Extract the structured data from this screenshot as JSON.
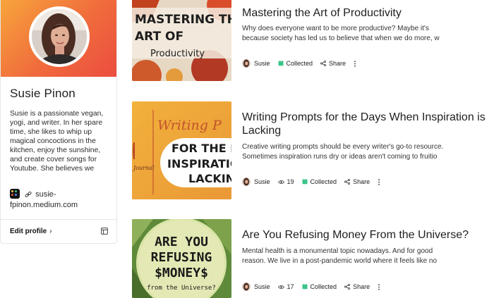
{
  "profile": {
    "name": "Susie Pinon",
    "bio": "Susie is a passionate vegan, yogi, and writer. In her spare time, she likes to whip up magical concoctions in the kitchen, enjoy the sunshine, and create cover songs for Youtube. She believes we",
    "link_line1": "susie-",
    "link_line2": "fpinon.medium.com",
    "edit_label": "Edit profile",
    "edit_chevron": "›"
  },
  "articles": [
    {
      "title": "Mastering the Art of Productivity",
      "excerpt_line1": "Why does everyone want to be more productive? Maybe it's",
      "excerpt_line2": "because society has led us to believe that when we do more, w",
      "thumb_text": [
        "MASTERING THE",
        "ART OF",
        "Productivity"
      ],
      "author": "Susie",
      "views": "",
      "collected": "Collected",
      "share": "Share"
    },
    {
      "title": "Writing Prompts for the Days When Inspiration is Lacking",
      "excerpt_line1": "Creative writing prompts should be every writer's go-to resource.",
      "excerpt_line2": "Sometimes inspiration runs dry or ideas aren't coming to fruitio",
      "thumb_text": [
        "Writing P",
        "FOR THE D",
        "INSPIRATIO",
        "LACKIN",
        "Journal"
      ],
      "author": "Susie",
      "views": "19",
      "collected": "Collected",
      "share": "Share"
    },
    {
      "title": "Are You Refusing Money From the Universe?",
      "excerpt_line1": "Mental health is a monumental topic nowadays. And for good",
      "excerpt_line2": "reason. We live in a post-pandemic world where it feels like no",
      "thumb_text": [
        "ARE YOU",
        "REFUSING",
        "$MONEY$",
        "from the Universe?"
      ],
      "author": "Susie",
      "views": "17",
      "collected": "Collected",
      "share": "Share"
    }
  ],
  "colors": {
    "banner_start": "#f7a63c",
    "banner_end": "#ec4d3f",
    "collected_icon": "#3cc48a"
  },
  "icons": {
    "medium_badge": "medium-logo-icon",
    "link": "link-icon",
    "layout": "layout-icon",
    "views": "eye-icon",
    "collected": "bookmark-icon",
    "share": "share-icon",
    "more": "more-vertical-icon"
  }
}
